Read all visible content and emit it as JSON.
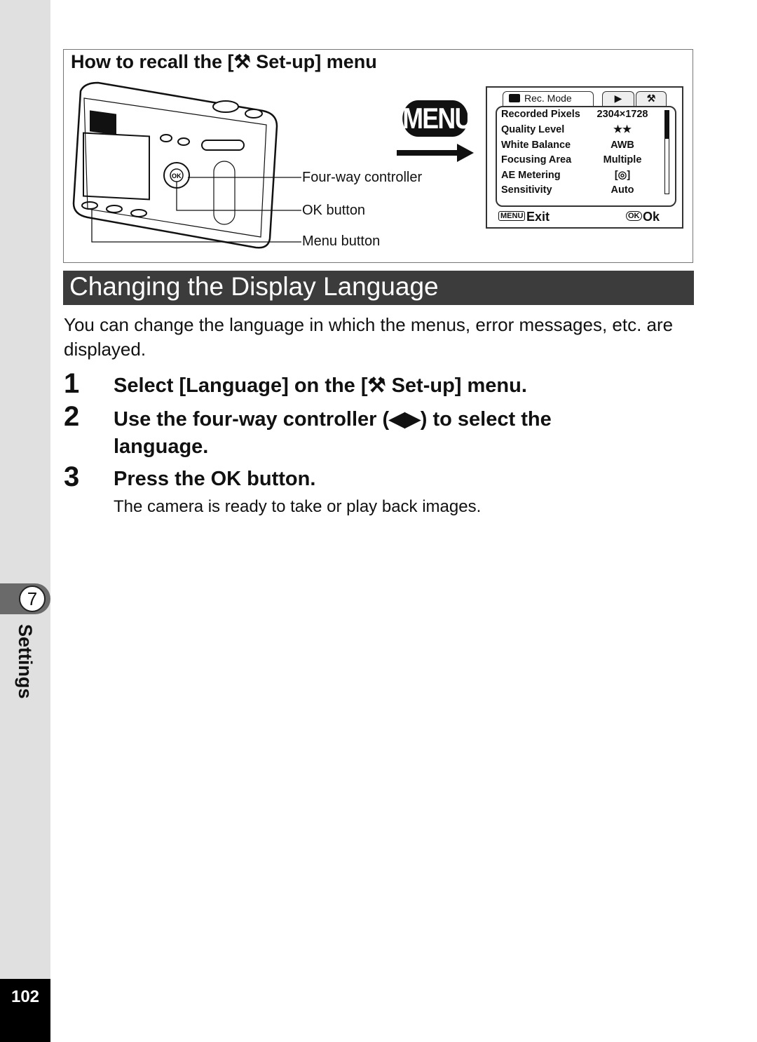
{
  "sidebar": {
    "chapter_number": "7",
    "chapter_title": "Settings",
    "page_number": "102"
  },
  "recall_box": {
    "title": "How to recall the [⚒ Set-up] menu",
    "callouts": [
      "Four-way controller",
      "OK button",
      "Menu button"
    ],
    "menu_key_label": "MENU",
    "screen": {
      "tabs": [
        "Rec. Mode",
        "▶",
        "⚒"
      ],
      "rows": [
        {
          "label": "Recorded Pixels",
          "value": "2304×1728"
        },
        {
          "label": "Quality Level",
          "value": "★★"
        },
        {
          "label": "White Balance",
          "value": "AWB"
        },
        {
          "label": "Focusing Area",
          "value": "Multiple"
        },
        {
          "label": "AE Metering",
          "value": "[◎]"
        },
        {
          "label": "Sensitivity",
          "value": "Auto"
        }
      ],
      "footer_left_key": "MENU",
      "footer_left": "Exit",
      "footer_right_key": "OK",
      "footer_right": "Ok"
    }
  },
  "section": {
    "title": "Changing the Display Language",
    "intro": "You can change the language in which the menus, error messages, etc. are displayed.",
    "steps": [
      {
        "num": "1",
        "text": "Select [Language] on the [⚒ Set-up] menu."
      },
      {
        "num": "2",
        "text": "Use the four-way controller (◀▶) to select the language."
      },
      {
        "num": "3",
        "text": "Press the OK button."
      }
    ],
    "step3_note": "The camera is ready to take or play back images."
  }
}
